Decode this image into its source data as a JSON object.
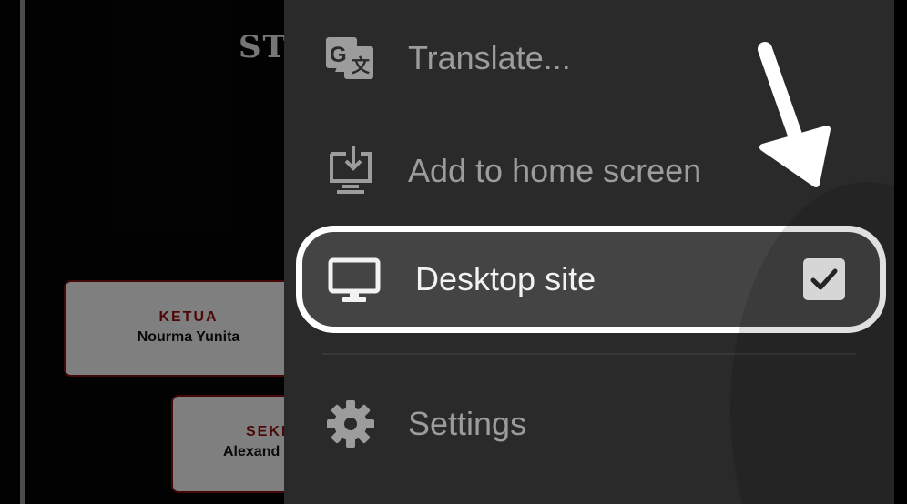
{
  "background_page": {
    "heading": "ST",
    "cards": [
      {
        "role": "KETUA",
        "name": "Nourma Yunita"
      },
      {
        "role": "SEKI",
        "name": "Alexand"
      }
    ]
  },
  "menu": {
    "items": [
      {
        "label": "Translate...",
        "icon": "google-translate-icon"
      },
      {
        "label": "Add to home screen",
        "icon": "add-to-home-screen-icon"
      },
      {
        "label": "Desktop site",
        "icon": "desktop-monitor-icon",
        "checked": true
      },
      {
        "label": "Settings",
        "icon": "gear-icon"
      }
    ]
  },
  "colors": {
    "menu_background": "#2a2a2a",
    "highlight_background": "#444444",
    "highlight_border": "#ffffff",
    "card_role": "#8b0d0d"
  }
}
